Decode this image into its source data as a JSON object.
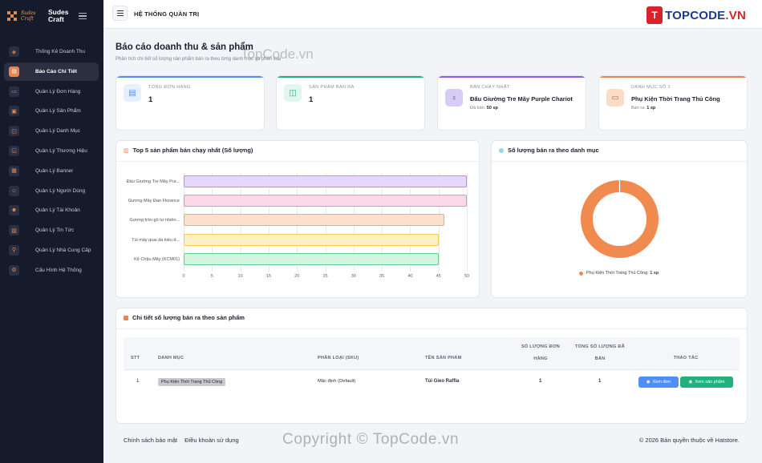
{
  "brand": {
    "script": "Sudes Craft",
    "name_line1": "Sudes",
    "name_line2": "Craft"
  },
  "sidebar": {
    "items": [
      {
        "label": "Thống Kê Doanh Thu",
        "icon": "cube-icon",
        "active": false
      },
      {
        "label": "Báo Cáo Chi Tiết",
        "icon": "chart-bar-icon",
        "active": true
      },
      {
        "label": "Quản Lý Đơn Hàng",
        "icon": "order-icon",
        "active": false
      },
      {
        "label": "Quản Lý Sản Phẩm",
        "icon": "product-icon",
        "active": false
      },
      {
        "label": "Quản Lý Danh Mục",
        "icon": "category-icon",
        "active": false
      },
      {
        "label": "Quản Lý Thương Hiệu",
        "icon": "brand-icon",
        "active": false
      },
      {
        "label": "Quản Lý Banner",
        "icon": "banner-icon",
        "active": false
      },
      {
        "label": "Quản Lý Người Dùng",
        "icon": "users-icon",
        "active": false
      },
      {
        "label": "Quản Lý Tài Khoản",
        "icon": "account-icon",
        "active": false
      },
      {
        "label": "Quản Lý Tin Tức",
        "icon": "news-icon",
        "active": false
      },
      {
        "label": "Quản Lý Nhà Cung Cấp",
        "icon": "supplier-icon",
        "active": false
      },
      {
        "label": "Cấu Hình Hệ Thống",
        "icon": "gear-icon",
        "active": false
      }
    ]
  },
  "topbar": {
    "title": "HỆ THỐNG QUẢN TRỊ",
    "logo_badge": "T",
    "logo_text_main": "TOPCODE",
    "logo_text_tld": ".VN"
  },
  "page": {
    "title": "Báo cáo doanh thu & sản phẩm",
    "subtitle": "Phân tích chi tiết số lượng sản phẩm bán ra theo từng danh mục và phân loại",
    "watermark_top": "TopCode.vn",
    "watermark_bottom": "Copyright © TopCode.vn"
  },
  "stats": [
    {
      "label": "TỔNG ĐƠN HÀNG",
      "value": "1",
      "sub_prefix": "",
      "sub_value": "",
      "color": "#4f8ef7",
      "icon_bg": "#e6efff",
      "icon_fg": "#4f8ef7",
      "icon": "file-icon"
    },
    {
      "label": "SẢN PHẨM BÁN RA",
      "value": "1",
      "sub_prefix": "",
      "sub_value": "",
      "color": "#22b07d",
      "icon_bg": "#e0f6ee",
      "icon_fg": "#22b07d",
      "icon": "bag-icon"
    },
    {
      "label": "BÁN CHẠY NHẤT",
      "value": "Đấu Giường Tre Mây Purple Chariot",
      "sub_prefix": "Đã bán: ",
      "sub_value": "50 sp",
      "color": "#8b5cf6",
      "icon_bg": "#d7ccf5",
      "icon_fg": "#5b3fb5",
      "icon": "medal-icon"
    },
    {
      "label": "DANH MỤC SỐ 1",
      "value": "Phụ Kiện Thời Trang Thủ Công",
      "sub_prefix": "Bán ra: ",
      "sub_value": "1 sp",
      "color": "#e8844e",
      "icon_bg": "#fbdcc9",
      "icon_fg": "#c9642e",
      "icon": "folder-icon"
    }
  ],
  "bar_section": {
    "title": "Top 5 sản phẩm bán chạy nhất (Số lượng)"
  },
  "donut_section": {
    "title": "Số lượng bán ra theo danh mục"
  },
  "chart_data": [
    {
      "type": "bar",
      "orientation": "horizontal",
      "title": "Top 5 sản phẩm bán chạy nhất (Số lượng)",
      "categories": [
        "Đấu Giường Tre Mây Pur...",
        "Gương Mây Đan Florence",
        "Gương tròn gỗ tự nhiên...",
        "Túi mây quai da kiểu d...",
        "Kệ Chậu Mây (KCM01)"
      ],
      "values": [
        50,
        50,
        46,
        45,
        45
      ],
      "xlim": [
        0,
        50
      ],
      "xticks": [
        0,
        5,
        10,
        15,
        20,
        25,
        30,
        35,
        40,
        45,
        50
      ],
      "grid": true,
      "colors": [
        {
          "fill": "#e7d7fb",
          "stroke": "#b98ef0"
        },
        {
          "fill": "#fcd9e8",
          "stroke": "#ef8db8"
        },
        {
          "fill": "#fde1cf",
          "stroke": "#f3a877"
        },
        {
          "fill": "#fff0c4",
          "stroke": "#f0cb5d"
        },
        {
          "fill": "#d3f4df",
          "stroke": "#5fcf8b"
        }
      ]
    },
    {
      "type": "pie",
      "style": "donut",
      "title": "Số lượng bán ra theo danh mục",
      "slices": [
        {
          "name": "Phụ Kiện Thời Trang Thủ Công",
          "value": 1,
          "color": "#f08a4f"
        }
      ],
      "legend_placement": "bottom",
      "legend_value": "1 sp"
    }
  ],
  "table": {
    "title": "Chi tiết số lượng bán ra theo sản phẩm",
    "headers": {
      "stt": "STT",
      "category": "DANH MỤC",
      "sku": "PHÂN LOẠI (SKU)",
      "product": "TÊN SẢN PHẨM",
      "orders_l1": "SỐ LƯỢNG ĐƠN",
      "orders_l2": "HÀNG",
      "total_l1": "TỔNG SỐ LƯỢNG ĐÃ",
      "total_l2": "BÁN",
      "actions": "THAO TÁC"
    },
    "rows": [
      {
        "stt": "1",
        "category": "Phụ Kiện Thời Trang Thủ Công",
        "sku": "Mặc định (Default)",
        "product": "Túi Gieo Raffia",
        "orders": "1",
        "total": "1"
      }
    ],
    "btn_orders": "Xem đơn",
    "btn_product": "Xem sản phẩm"
  },
  "footer": {
    "privacy": "Chính sách bảo mật",
    "terms": "Điều khoản sử dụng",
    "copyright": "© 2026 Bản quyền thuộc về  Hatstore."
  }
}
